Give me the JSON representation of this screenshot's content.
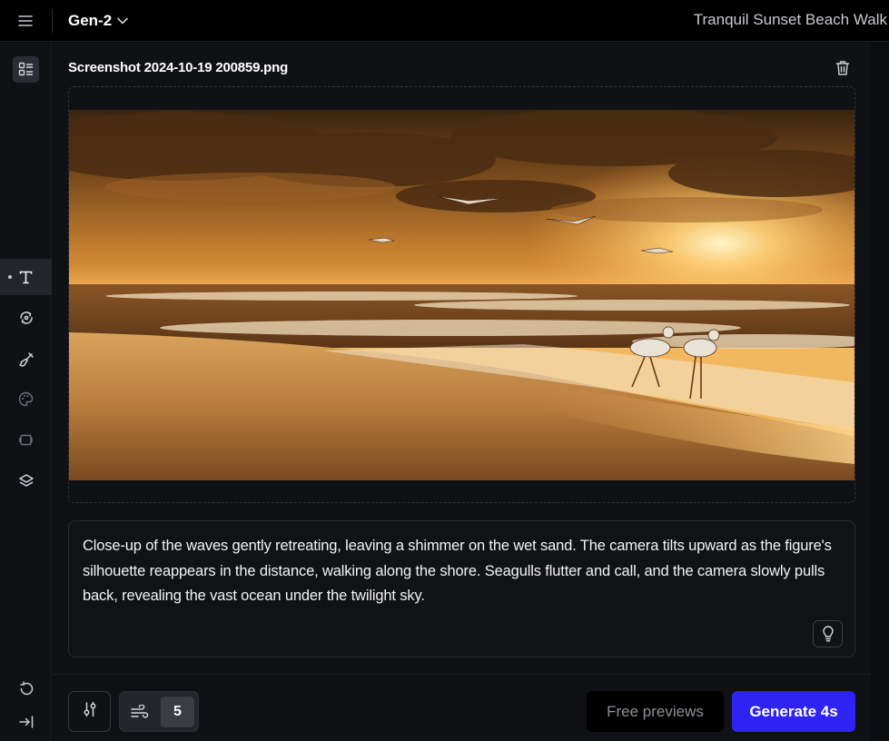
{
  "header": {
    "model_label": "Gen-2",
    "project_title": "Tranquil Sunset Beach Walk"
  },
  "sidebar": {
    "items": [
      {
        "name": "assets-panel-icon"
      },
      {
        "name": "text-tool-icon"
      },
      {
        "name": "camera-motion-icon"
      },
      {
        "name": "motion-brush-icon"
      },
      {
        "name": "style-palette-icon"
      },
      {
        "name": "frames-icon"
      },
      {
        "name": "layers-icon"
      },
      {
        "name": "reset-icon"
      },
      {
        "name": "collapse-panel-icon"
      }
    ]
  },
  "media": {
    "filename": "Screenshot 2024-10-19 200859.png"
  },
  "prompt": {
    "text": "Close-up of the waves gently retreating, leaving a shimmer on the wet sand. The camera tilts upward as the figure's silhouette reappears in the distance, walking along the shore. Seagulls flutter and call, and the camera slowly pulls back, revealing the vast ocean under the twilight sky."
  },
  "controls": {
    "motion_value": "5",
    "free_previews_label": "Free previews",
    "generate_label": "Generate 4s"
  },
  "colors": {
    "accent": "#2e22f5",
    "background": "#101115",
    "topbar": "#000000"
  }
}
